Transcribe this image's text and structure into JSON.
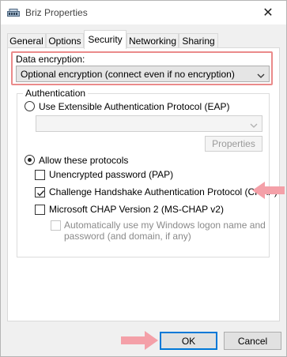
{
  "window": {
    "title": "Briz Properties"
  },
  "tabs": [
    {
      "label": "General"
    },
    {
      "label": "Options"
    },
    {
      "label": "Security"
    },
    {
      "label": "Networking"
    },
    {
      "label": "Sharing"
    }
  ],
  "active_tab": "Security",
  "security": {
    "data_encryption_label": "Data encryption:",
    "data_encryption_value": "Optional encryption (connect even if no encryption)",
    "authentication_legend": "Authentication",
    "eap_label": "Use Extensible Authentication Protocol (EAP)",
    "eap_selected": false,
    "eap_dropdown_value": "",
    "properties_label": "Properties",
    "allow_protocols_label": "Allow these protocols",
    "allow_protocols_selected": true,
    "protocols": [
      {
        "label": "Unencrypted password (PAP)",
        "checked": false
      },
      {
        "label": "Challenge Handshake Authentication Protocol (CHAP)",
        "checked": true
      },
      {
        "label": "Microsoft CHAP Version 2 (MS-CHAP v2)",
        "checked": false
      }
    ],
    "auto_logon_line1": "Automatically use my Windows logon name and",
    "auto_logon_line2": "password (and domain, if any)",
    "auto_logon_checked": false
  },
  "buttons": {
    "ok": "OK",
    "cancel": "Cancel"
  },
  "colors": {
    "annotation": "#f4a0a8",
    "highlight_border": "#ea8a8a",
    "default_button_border": "#0078d7"
  }
}
